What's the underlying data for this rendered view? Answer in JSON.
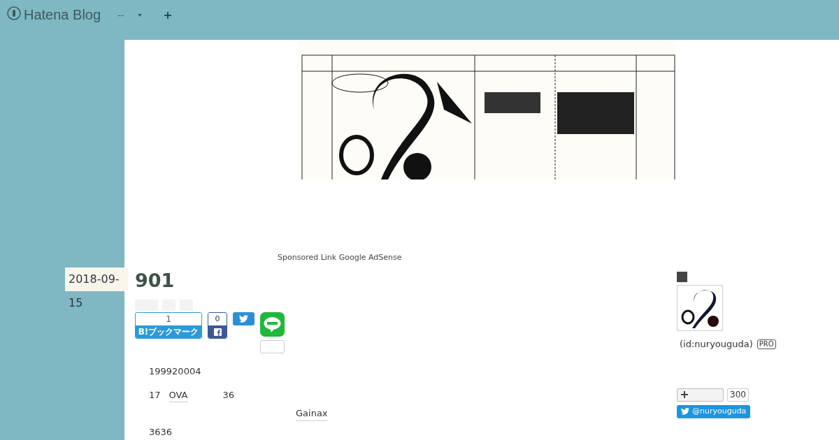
{
  "header": {
    "logo_text": "Hatena Blog",
    "menu_label": "--"
  },
  "ad_label": "Sponsored Link Google AdSense",
  "entry": {
    "date": "2018-09-15",
    "title": "901",
    "share": {
      "bookmark_count": "1",
      "bookmark_label": "B!ブックマーク",
      "facebook_count": "0"
    },
    "body": {
      "line_1": "199920004",
      "line_2_start": "17",
      "line_2_link": "OVA",
      "line_2_end": "36",
      "link_2": "Gainax",
      "line_3": "3636"
    }
  },
  "sidebar": {
    "user_id": "(id:nuryouguda)",
    "badge": "PRO",
    "follower_count": "300",
    "twitter_handle": "@nuryouguda"
  }
}
